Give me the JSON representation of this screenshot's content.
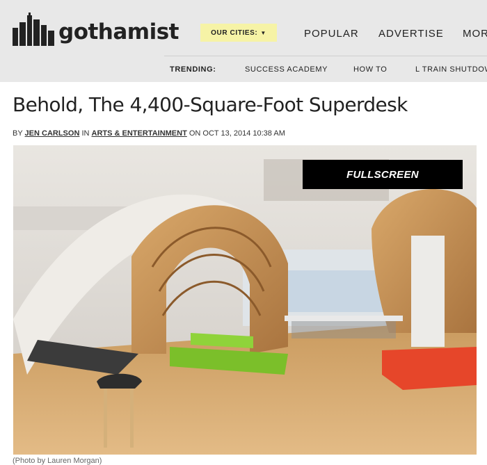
{
  "header": {
    "logo_text": "gothamist",
    "cities_label": "OUR CITIES:",
    "nav": [
      "POPULAR",
      "ADVERTISE",
      "MORE"
    ]
  },
  "trending": {
    "label": "TRENDING:",
    "items": [
      "SUCCESS ACADEMY",
      "HOW TO",
      "L TRAIN SHUTDOWN"
    ]
  },
  "article": {
    "title": "Behold, The 4,400-Square-Foot Superdesk",
    "byline": {
      "by": "BY",
      "author": "JEN CARLSON",
      "in": "IN",
      "category": "ARTS & ENTERTAINMENT",
      "on": "ON OCT 13, 2014 10:38 AM"
    },
    "fullscreen_label": "FULLSCREEN",
    "caption": "(Photo by Lauren Morgan)"
  },
  "colors": {
    "header_bg": "#e8e8e8",
    "cities_bg": "#f6f3a6",
    "fullscreen_bg": "#000000"
  }
}
